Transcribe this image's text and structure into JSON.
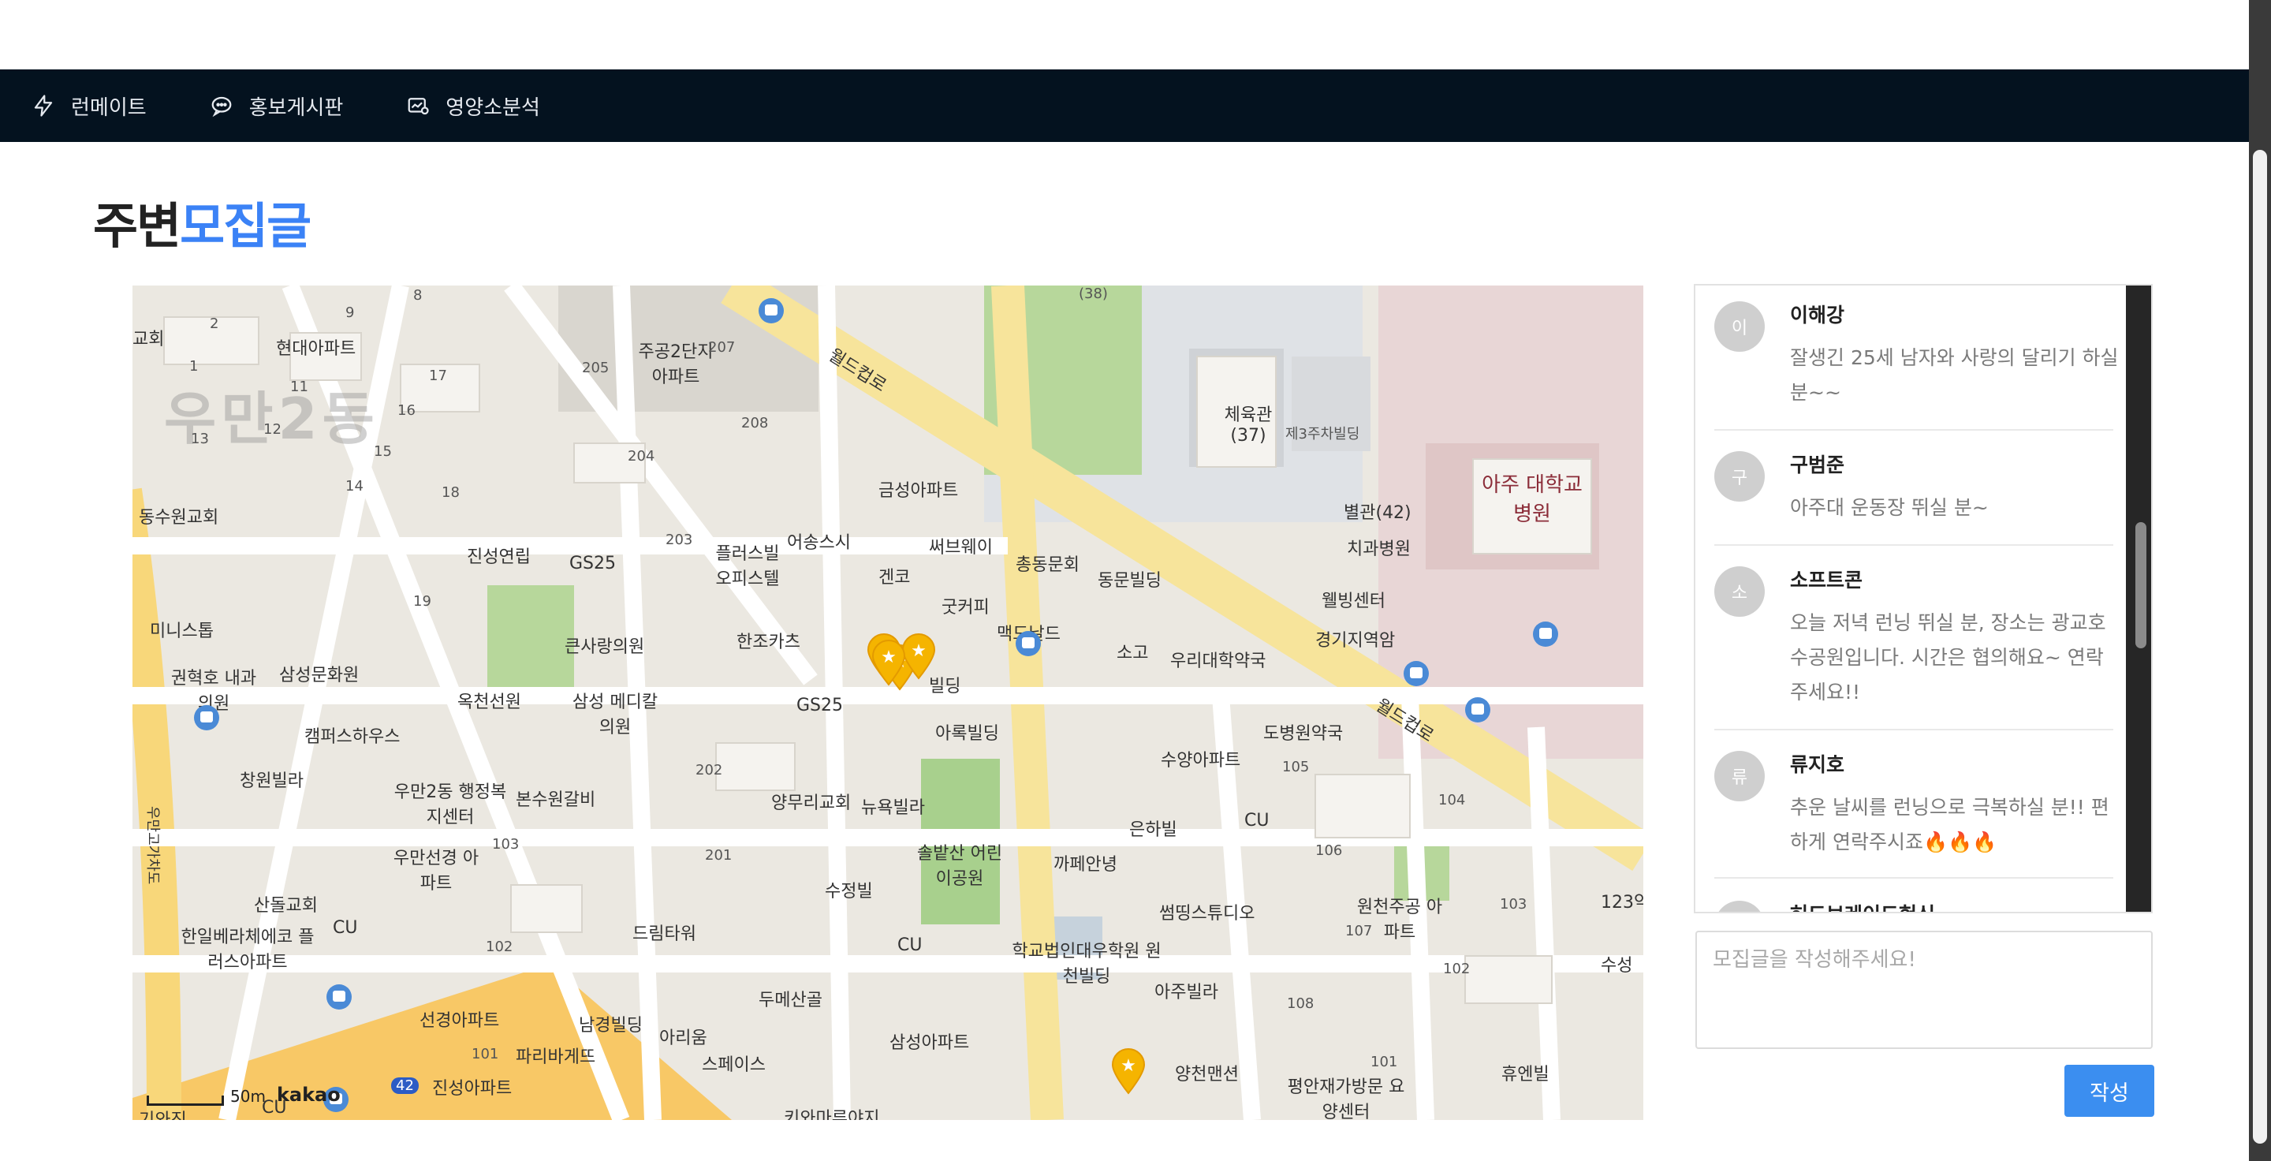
{
  "nav": {
    "items": [
      {
        "label": "런메이트",
        "icon": "bolt-icon"
      },
      {
        "label": "홍보게시판",
        "icon": "chat-icon"
      },
      {
        "label": "영양소분석",
        "icon": "chart-card-icon"
      }
    ]
  },
  "page": {
    "title_main": "주변",
    "title_accent": "모집글"
  },
  "map": {
    "area_label": "우만2동",
    "labels": {
      "l1": "교회",
      "l2": "현대아파트",
      "l3": "주공2단지 아파트",
      "l4": "동수원교회",
      "l5": "진성연립",
      "l6": "GS25",
      "l7": "플러스빌 오피스텔",
      "l8": "어송스시",
      "l9": "금성아파트",
      "l10": "써브웨이",
      "l11": "총동문회",
      "l12": "동문빌딩",
      "l13": "미니스톱",
      "l14": "큰사랑의원",
      "l15": "한조카츠",
      "l16": "겐코",
      "l17": "굿커피",
      "l18": "맥도날드",
      "l19": "소고",
      "l20": "우리대학약국",
      "l21": "권혁호 내과의원",
      "l22": "삼성문화원",
      "l23": "옥천선원",
      "l24": "삼성 메디칼의원",
      "l25": "GS25",
      "l26": "빌딩",
      "l27": "아록빌딩",
      "l28": "도병원약국",
      "l29": "캠퍼스하우스",
      "l30": "창원빌라",
      "l31": "우만2동 행정복지센터",
      "l32": "본수원갈비",
      "l33": "양무리교회",
      "l34": "뉴욕빌라",
      "l35": "수양아파트",
      "l36": "은하빌",
      "l37": "CU",
      "l38": "솔밭산 어린이공원",
      "l39": "까페안녕",
      "l40": "우만선경 아파트",
      "l41": "산돌교회",
      "l42": "CU",
      "l43": "수정빌",
      "l44": "드림타워",
      "l45": "CU",
      "l46": "학교법인대우학원 원천빌딩",
      "l47": "썸띵스튜디오",
      "l48": "원천주공 아파트",
      "l49": "한일베라체에코 플러스아파트",
      "l50": "두메산골",
      "l51": "아주빌라",
      "l52": "선경아파트",
      "l53": "남경빌딩",
      "l54": "아리움",
      "l55": "삼성아파트",
      "l56": "파리바게뜨",
      "l57": "스페이스",
      "l58": "양천맨션",
      "l59": "평안재가방문 요양센터",
      "l60": "휴엔빌",
      "l61": "CU",
      "l62": "진성아파트",
      "l63": "기와진",
      "l64": "키와마루야지",
      "l65": "체육관 (37)",
      "l66": "제3주차빌딩",
      "l67": "아주 대학교병원",
      "l68": "별관(42)",
      "l69": "치과병원",
      "l70": "웰빙센터",
      "l71": "경기지역암",
      "l72": "월드컵로",
      "l73": "월드컵로",
      "l74": "수성",
      "l75": "123약",
      "l76": "우만고가차도"
    },
    "numbers": [
      "9",
      "8",
      "2",
      "1",
      "11",
      "17",
      "16",
      "13",
      "12",
      "15",
      "14",
      "18",
      "205",
      "207",
      "208",
      "204",
      "203",
      "19",
      "202",
      "201",
      "103",
      "102",
      "101",
      "105",
      "104",
      "106",
      "107",
      "108",
      "103",
      "102",
      "101",
      "(38)",
      "42"
    ],
    "scale": {
      "distance": "50m",
      "logo": "kakao"
    },
    "marker_count": 5
  },
  "posts": [
    {
      "avatar": "이",
      "name": "이해강",
      "text": "잘생긴 25세 남자와 사랑의 달리기 하실 분~~"
    },
    {
      "avatar": "구",
      "name": "구범준",
      "text": "아주대 운동장 뛰실 분~"
    },
    {
      "avatar": "소",
      "name": "소프트콘",
      "text": "오늘 저녁 런닝 뛰실 분, 장소는 광교호수공원입니다. 시간은 협의해요~ 연락주세요!!"
    },
    {
      "avatar": "류",
      "name": "류지호",
      "text": "추운 날씨를 런닝으로 극복하실 분!! 편하게 연락주시죠🔥🔥🔥"
    },
    {
      "avatar": "허",
      "name": "허드브레이드헌신",
      "text": ""
    }
  ],
  "compose": {
    "placeholder": "모집글을 작성해주세요!",
    "value": ""
  },
  "submit_label": "작성",
  "colors": {
    "nav_bg": "#04121f",
    "accent": "#3b82f6",
    "button": "#3b8ef0",
    "marker": "#f5b400"
  }
}
